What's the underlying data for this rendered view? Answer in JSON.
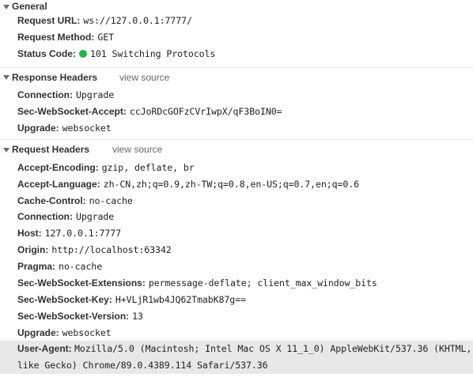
{
  "general": {
    "title": "General",
    "request_url_key": "Request URL:",
    "request_url": "ws://127.0.0.1:7777/",
    "request_method_key": "Request Method:",
    "request_method": "GET",
    "status_code_key": "Status Code:",
    "status_code": "101 Switching Protocols",
    "status_color": "#21b547"
  },
  "response_headers": {
    "title": "Response Headers",
    "view_source": "view source",
    "rows": [
      {
        "key": "Connection:",
        "value": "Upgrade"
      },
      {
        "key": "Sec-WebSocket-Accept:",
        "value": "ccJoRDcGOFzCVrIwpX/qF3BoIN0="
      },
      {
        "key": "Upgrade:",
        "value": "websocket"
      }
    ]
  },
  "request_headers": {
    "title": "Request Headers",
    "view_source": "view source",
    "rows": [
      {
        "key": "Accept-Encoding:",
        "value": "gzip, deflate, br"
      },
      {
        "key": "Accept-Language:",
        "value": "zh-CN,zh;q=0.9,zh-TW;q=0.8,en-US;q=0.7,en;q=0.6"
      },
      {
        "key": "Cache-Control:",
        "value": "no-cache"
      },
      {
        "key": "Connection:",
        "value": "Upgrade"
      },
      {
        "key": "Host:",
        "value": "127.0.0.1:7777"
      },
      {
        "key": "Origin:",
        "value": "http://localhost:63342"
      },
      {
        "key": "Pragma:",
        "value": "no-cache"
      },
      {
        "key": "Sec-WebSocket-Extensions:",
        "value": "permessage-deflate; client_max_window_bits"
      },
      {
        "key": "Sec-WebSocket-Key:",
        "value": "H+VLjR1wb4JQ62TmabK87g=="
      },
      {
        "key": "Sec-WebSocket-Version:",
        "value": "13"
      },
      {
        "key": "Upgrade:",
        "value": "websocket"
      }
    ],
    "user_agent_key": "User-Agent:",
    "user_agent": "Mozilla/5.0 (Macintosh; Intel Mac OS X 11_1_0) AppleWebKit/537.36 (KHTML, like Gecko) Chrome/89.0.4389.114 Safari/537.36"
  }
}
